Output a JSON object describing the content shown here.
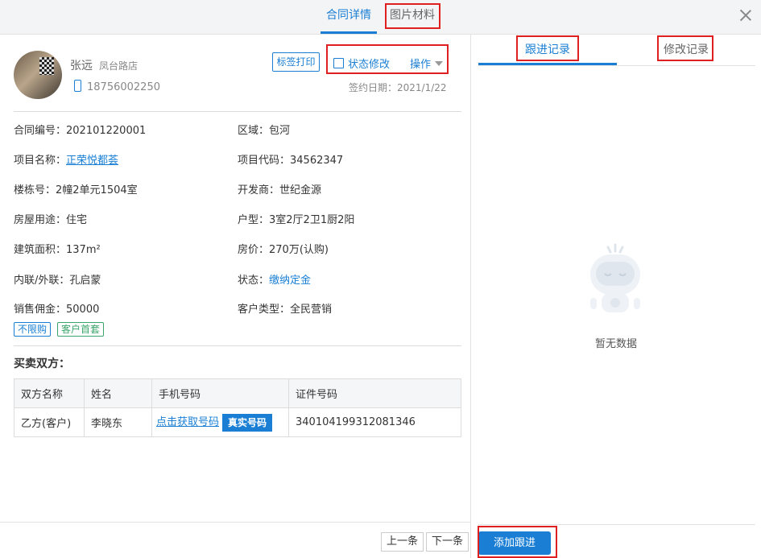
{
  "tabs": {
    "contract_detail": "合同详情",
    "image_materials": "图片材料"
  },
  "agent": {
    "name": "张远",
    "store": "凤台路店",
    "phone": "18756002250"
  },
  "actions": {
    "print_tag": "标签打印",
    "status_edit": "状态修改",
    "operations": "操作"
  },
  "sign_date": "签约日期：2021/1/22",
  "fields": {
    "contract_no": {
      "label": "合同编号：",
      "value": "202101220001"
    },
    "district": {
      "label": "区域：",
      "value": "包河"
    },
    "project_name": {
      "label": "项目名称：",
      "value": "正荣悦都荟"
    },
    "project_code": {
      "label": "项目代码：",
      "value": "34562347"
    },
    "unit": {
      "label": "楼栋号：",
      "value": "2幢2单元1504室"
    },
    "developer": {
      "label": "开发商：",
      "value": "世纪金源"
    },
    "usage": {
      "label": "房屋用途：",
      "value": "住宅"
    },
    "layout": {
      "label": "户型：",
      "value": "3室2厅2卫1厨2阳"
    },
    "area": {
      "label": "建筑面积：",
      "value": "137m²"
    },
    "price": {
      "label": "房价：",
      "value": "270万(认购)"
    },
    "affiliation": {
      "label": "内联/外联：",
      "value": "孔启蒙"
    },
    "status": {
      "label": "状态：",
      "value": "缴纳定金"
    },
    "commission": {
      "label": "销售佣金：",
      "value": "50000"
    },
    "customer_type": {
      "label": "客户类型：",
      "value": "全民营销"
    }
  },
  "tags": [
    "不限购",
    "客户首套"
  ],
  "parties": {
    "title": "买卖双方：",
    "headers": [
      "双方名称",
      "姓名",
      "手机号码",
      "证件号码"
    ],
    "rows": [
      {
        "side": "乙方(客户)",
        "name": "李晓东",
        "phone_link": "点击获取号码",
        "real_btn": "真实号码",
        "id_no": "340104199312081346"
      }
    ]
  },
  "pager": {
    "prev": "上一条",
    "next": "下一条"
  },
  "right_tabs": {
    "follow": "跟进记录",
    "modify": "修改记录"
  },
  "empty_text": "暂无数据",
  "add_follow": "添加跟进",
  "colors": {
    "accent": "#1a7fd4",
    "highlight": "#e02020",
    "tag_green": "#3aa56a"
  }
}
